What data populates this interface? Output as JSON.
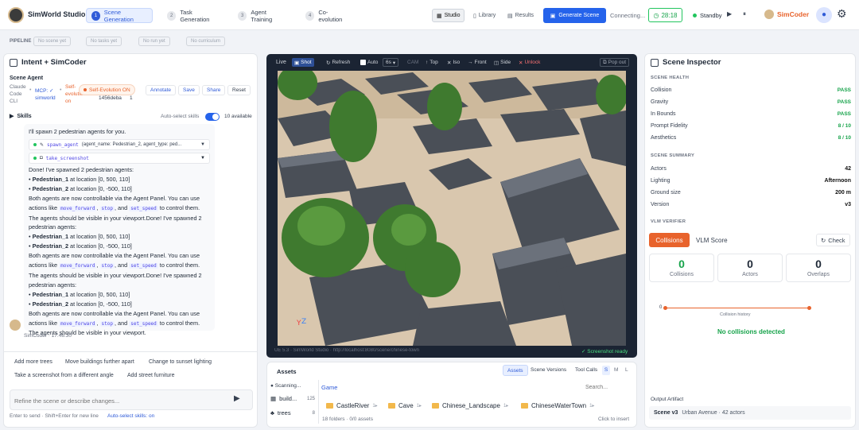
{
  "app": {
    "title": "SimWorld Studio"
  },
  "steps": [
    {
      "n": "1",
      "label": "Scene Generation"
    },
    {
      "n": "2",
      "label": "Task Generation"
    },
    {
      "n": "3",
      "label": "Agent Training"
    },
    {
      "n": "4",
      "label": "Co-evolution"
    }
  ],
  "toolbar": {
    "studio": "Studio",
    "library": "Library",
    "results": "Results",
    "generate": "Generate Scene",
    "status": "Connecting...",
    "timer": "28:18",
    "standby": "Standby",
    "user": "SimCoder"
  },
  "pipeline": {
    "label": "PIPELINE",
    "chips": [
      "No scene yet",
      "No tasks yet",
      "No run yet",
      "No curriculum"
    ]
  },
  "left": {
    "title": "Intent + SimCoder",
    "scene_agent": "Scene Agent",
    "agent_cli_l1": "Claude",
    "agent_cli_l2": "Code",
    "agent_cli_l3": "CLI",
    "mcp_l1": "MCP: ✓",
    "mcp_l2": "simworld",
    "self_evo_l1": "Self-",
    "self_evo_l2": "evolution",
    "self_evo_l3": "on",
    "self_evo_badge": "Self-Evolution ON",
    "session": "1456deba",
    "count": "1",
    "annotate": "Annotate",
    "save": "Save",
    "share": "Share",
    "reset": "Reset",
    "skills": "Skills",
    "auto_select": "Auto-select skills",
    "available": "10 available",
    "intro": "I'll spawn 2 pedestrian agents for you.",
    "tool1_name": "spawn_agent",
    "tool1_args": "(agent_name: Pedestrian_2, agent_type: ped...",
    "tool2_name": "take_screenshot",
    "done_line": "Done! I've spawned 2 pedestrian agents:",
    "p1_name": "Pedestrian_1",
    "p1_loc": " at location [0, 500, 110]",
    "p2_name": "Pedestrian_2",
    "p2_loc": " at location [0, -500, 110]",
    "body1": "Both agents are now controllable via the Agent Panel. You can use",
    "actions_like": "actions like ",
    "c1": "move_forward",
    "c2": "stop",
    "and": ", and ",
    "c3": "set_speed",
    "tail": " to control them.",
    "visible_done": "The agents should be visible in your viewport.Done! I've spawned 2",
    "ped_agents": "pedestrian agents:",
    "visible_final": "The agents should be visible in your viewport.",
    "author": "SimCoder · 17:46:30",
    "suggestions": [
      "Add more trees",
      "Move buildings further apart",
      "Change to sunset lighting",
      "Take a screenshot from a different angle",
      "Add street furniture"
    ],
    "input_placeholder": "Refine the scene or describe changes...",
    "hint": "Enter to send · Shift+Enter for new line",
    "hint_auto": "Auto-select skills: on"
  },
  "viewport": {
    "live": "Live",
    "shot": "Shot",
    "refresh": "Refresh",
    "auto": "Auto",
    "fps": "6s",
    "cam": "CAM",
    "top": "Top",
    "iso": "Iso",
    "front": "Front",
    "side": "Side",
    "unlock": "Unlock",
    "popout": "Pop out",
    "footer": "UE 5.3 · SimWorld Studio · http://localhost:8080/scene/chinese-town",
    "ready": "Screenshot ready"
  },
  "assets": {
    "title": "Assets",
    "tabs": [
      "Assets",
      "Scene Versions",
      "Tool Calls"
    ],
    "sizes": [
      "S",
      "M",
      "L"
    ],
    "scanning": "Scanning...",
    "cat1": "build...",
    "cat1_count": "125",
    "cat2": "trees",
    "cat2_count": "8",
    "breadcrumb": "Game",
    "search": "Search...",
    "folders": [
      "CastleRiver",
      "Cave",
      "Chinese_Landscape",
      "ChineseWaterTown"
    ],
    "counts": "18 folders · 0/0 assets",
    "click": "Click to insert"
  },
  "inspector": {
    "title": "Scene Inspector",
    "health": "SCENE HEALTH",
    "checks": [
      {
        "k": "Collision",
        "v": "PASS"
      },
      {
        "k": "Gravity",
        "v": "PASS"
      },
      {
        "k": "In Bounds",
        "v": "PASS"
      },
      {
        "k": "Prompt Fidelity",
        "v": "8 / 10"
      },
      {
        "k": "Aesthetics",
        "v": "8 / 10"
      }
    ],
    "summary": "SCENE SUMMARY",
    "rows": [
      {
        "k": "Actors",
        "v": "42"
      },
      {
        "k": "Lighting",
        "v": "Afternoon"
      },
      {
        "k": "Ground size",
        "v": "200 m"
      },
      {
        "k": "Version",
        "v": "v3"
      }
    ],
    "vlm": "VLM VERIFIER",
    "collisions_tab": "Collisions",
    "vlm_tab": "VLM Score",
    "check": "Check",
    "stats": [
      {
        "n": "0",
        "l": "Collisions"
      },
      {
        "n": "0",
        "l": "Actors"
      },
      {
        "n": "0",
        "l": "Overlaps"
      }
    ],
    "chart_y": "0",
    "chart_x": "Collision history",
    "no_coll": "No collisions detected",
    "artifact": "Output Artifact",
    "artifact_scene": "Scene v3",
    "artifact_desc": "Urban Avenue · 42 actors"
  },
  "colors": {
    "accent": "#2563eb",
    "pass": "#16a34a",
    "orange": "#e8632c"
  }
}
